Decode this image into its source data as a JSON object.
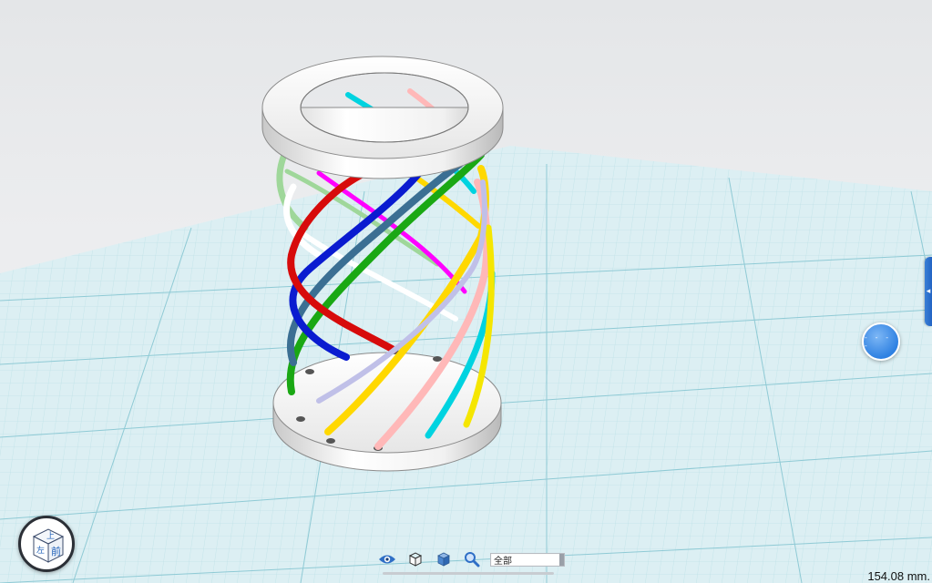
{
  "viewport": {
    "background": "#e9ebed",
    "grid_color": "#9fd3dc",
    "grid_fill": "#dbeef2"
  },
  "model": {
    "ring_color": "#f7f7f7",
    "spiral_colors": [
      "#1aa814",
      "#3b6f93",
      "#0a1bd0",
      "#d70b0b",
      "#ffffff",
      "#9fd79a",
      "#ff00ff",
      "#ffd800",
      "#00d3e0",
      "#ffb8b8",
      "#c0c0e8",
      "#f5e600"
    ]
  },
  "view_cube": {
    "top_label": "上",
    "left_label": "左",
    "front_label": "前"
  },
  "side_panel": {
    "handle_icon": "chevron-left-icon",
    "handle_label": "◂"
  },
  "float_button": {
    "icon": "dashed-circle-icon",
    "label": "- - - -"
  },
  "toolbar": {
    "eye_icon": "eye-icon",
    "wire_icon": "wireframe-cube-icon",
    "solid_icon": "solid-cube-icon",
    "zoom_icon": "magnifier-icon",
    "filter_value": "全部"
  },
  "status": {
    "scale": "154.08 mm."
  }
}
